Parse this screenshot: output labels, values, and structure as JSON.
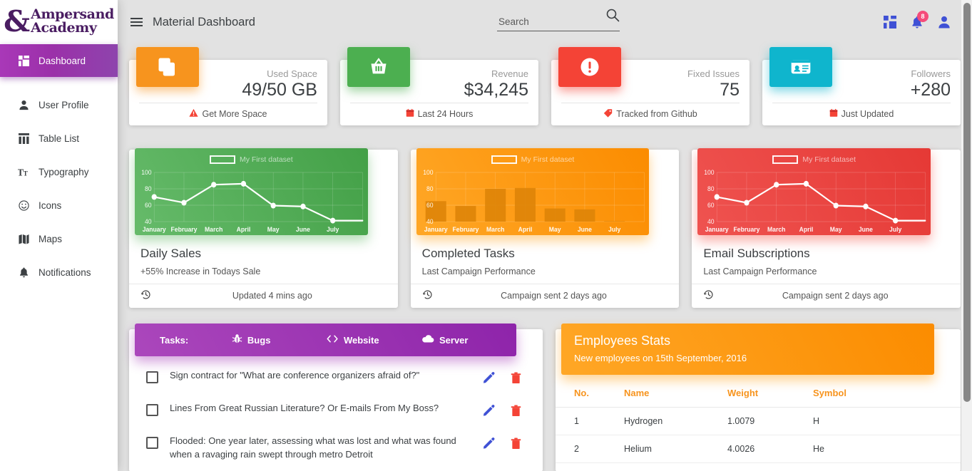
{
  "brand": {
    "amp": "&",
    "line1": "Ampersand",
    "line2": "Academy"
  },
  "sidebar": {
    "items": [
      {
        "label": "Dashboard",
        "icon": "dashboard-grid-icon",
        "active": true
      },
      {
        "label": "User Profile",
        "icon": "person-icon",
        "active": false
      },
      {
        "label": "Table List",
        "icon": "table-icon",
        "active": false
      },
      {
        "label": "Typography",
        "icon": "typography-icon",
        "active": false
      },
      {
        "label": "Icons",
        "icon": "smiley-icon",
        "active": false
      },
      {
        "label": "Maps",
        "icon": "map-icon",
        "active": false
      },
      {
        "label": "Notifications",
        "icon": "bell-icon",
        "active": false
      }
    ]
  },
  "topbar": {
    "menu_icon": "hamburger-icon",
    "title": "Material Dashboard",
    "search": {
      "value": "",
      "placeholder": "Search",
      "icon": "search-icon"
    },
    "icons": [
      {
        "name": "dashboard-grid-icon",
        "badge": ""
      },
      {
        "name": "bell-icon",
        "badge": "8"
      },
      {
        "name": "person-icon",
        "badge": ""
      }
    ],
    "notification_count": "8"
  },
  "stats": [
    {
      "icon": "copy-icon",
      "color": "#f7941e",
      "label": "Used Space",
      "value": "49/50 GB",
      "foot_icon": "warning-icon",
      "foot_icon_color": "#f44336",
      "foot": "Get More Space"
    },
    {
      "icon": "basket-icon",
      "color": "#4caf50",
      "label": "Revenue",
      "value": "$34,245",
      "foot_icon": "calendar-icon",
      "foot_icon_color": "#f44336",
      "foot": "Last 24 Hours"
    },
    {
      "icon": "alert-icon",
      "color": "#f44336",
      "label": "Fixed Issues",
      "value": "75",
      "foot_icon": "tag-icon",
      "foot_icon_color": "#f44336",
      "foot": "Tracked from Github"
    },
    {
      "icon": "contact-card-icon",
      "color": "#0fb5cd",
      "label": "Followers",
      "value": "+280",
      "foot_icon": "calendar-icon",
      "foot_icon_color": "#f44336",
      "foot": "Just Updated"
    }
  ],
  "charts": [
    {
      "title": "Daily Sales",
      "subtitle": "+55% Increase in Todays Sale",
      "foot_icon": "history-icon",
      "foot": "Updated 4 mins ago",
      "color": "#4caf50"
    },
    {
      "title": "Completed Tasks",
      "subtitle": "Last Campaign Performance",
      "foot_icon": "history-icon",
      "foot": "Campaign sent 2 days ago",
      "color": "#ff9800"
    },
    {
      "title": "Email Subscriptions",
      "subtitle": "Last Campaign Performance",
      "foot_icon": "history-icon",
      "foot": "Campaign sent 2 days ago",
      "color": "#f44336"
    }
  ],
  "chart_data": [
    {
      "type": "line",
      "title": "Daily Sales",
      "legend": "My First dataset",
      "legend_position": "top-center",
      "categories": [
        "January",
        "February",
        "March",
        "April",
        "May",
        "June",
        "July"
      ],
      "values": [
        65,
        58,
        80,
        81,
        56,
        55,
        40
      ],
      "yticks": [
        40,
        60,
        80,
        100
      ],
      "ylim": [
        33,
        104
      ],
      "xlabel": "",
      "ylabel": "",
      "grid": true,
      "line_color": "#ffffff",
      "bg_color": "#4caf50"
    },
    {
      "type": "bar",
      "title": "Completed Tasks",
      "legend": "My First dataset",
      "legend_position": "top-center",
      "categories": [
        "January",
        "February",
        "March",
        "April",
        "May",
        "June",
        "July"
      ],
      "values": [
        65,
        59,
        80,
        81,
        56,
        55,
        40
      ],
      "yticks": [
        40,
        60,
        80,
        100
      ],
      "ylim": [
        40,
        104
      ],
      "xlabel": "",
      "ylabel": "",
      "grid": true,
      "bar_color": "rgba(230,140,10,0.85)",
      "bg_color": "#ff9800"
    },
    {
      "type": "line",
      "title": "Email Subscriptions",
      "legend": "My First dataset",
      "legend_position": "top-center",
      "categories": [
        "January",
        "February",
        "March",
        "April",
        "May",
        "June",
        "July"
      ],
      "values": [
        65,
        58,
        80,
        81,
        56,
        55,
        40
      ],
      "yticks": [
        40,
        60,
        80,
        100
      ],
      "ylim": [
        33,
        104
      ],
      "xlabel": "",
      "ylabel": "",
      "grid": true,
      "line_color": "#ffffff",
      "bg_color": "#f44336"
    }
  ],
  "tasks_panel": {
    "label": "Tasks:",
    "tabs": [
      {
        "label": "Bugs",
        "icon": "bug-icon"
      },
      {
        "label": "Website",
        "icon": "code-icon"
      },
      {
        "label": "Server",
        "icon": "cloud-icon"
      }
    ],
    "items": [
      {
        "checked": false,
        "text": "Sign contract for \"What are conference organizers afraid of?\""
      },
      {
        "checked": false,
        "text": "Lines From Great Russian Literature? Or E-mails From My Boss?"
      },
      {
        "checked": false,
        "text": "Flooded: One year later, assessing what was lost and what was found when a ravaging rain swept through metro Detroit"
      }
    ],
    "edit_icon": "pencil-icon",
    "delete_icon": "trash-icon"
  },
  "employees": {
    "title": "Employees Stats",
    "subtitle": "New employees on 15th September, 2016",
    "columns": [
      "No.",
      "Name",
      "Weight",
      "Symbol"
    ],
    "rows": [
      [
        "1",
        "Hydrogen",
        "1.0079",
        "H"
      ],
      [
        "2",
        "Helium",
        "4.0026",
        "He"
      ]
    ]
  },
  "colors": {
    "accent_purple": "#9c27b0",
    "brand_purple": "#4a1d62",
    "orange": "#f7941e",
    "green": "#4caf50",
    "red": "#f44336",
    "cyan": "#0fb5cd",
    "page_bg": "#e2e2e2"
  }
}
